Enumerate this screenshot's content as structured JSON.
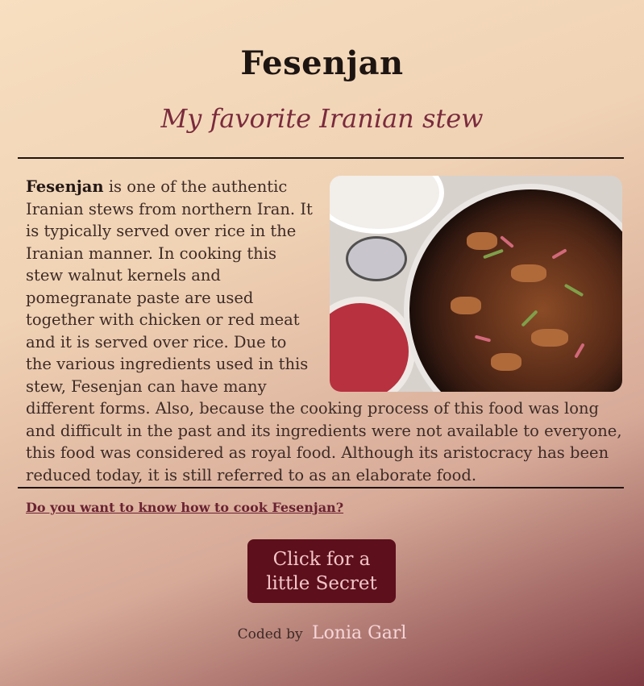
{
  "header": {
    "title": "Fesenjan",
    "subtitle": "My favorite Iranian stew"
  },
  "article": {
    "dish_name": "Fesenjan",
    "body": " is one of the authentic Iranian stews from northern Iran. It is typically served over rice in the Iranian manner. In cooking this stew walnut kernels and pomegranate paste are used together with chicken or red meat and it is served over rice. Due to the various ingredients used in this stew, Fesenjan can have many different forms. Also, because the cooking process of this food was long and difficult in the past and its ingredients were not available to everyone, this food was considered as royal food. Although its aristocracy has been reduced today, it is still referred to as an elaborate food.",
    "image_alt": "Fesenjan stew in a pot"
  },
  "footer": {
    "link_text": "Do you want to know how to cook Fesenjan?",
    "button_label": "Click for a little Secret",
    "credit_prefix": "Coded by",
    "credit_author": "Lonia Garl"
  },
  "colors": {
    "accent": "#5d0f1c",
    "subtitle": "#7a2b3d",
    "background_start": "#f7dfc0",
    "background_end": "#7f3b42"
  }
}
